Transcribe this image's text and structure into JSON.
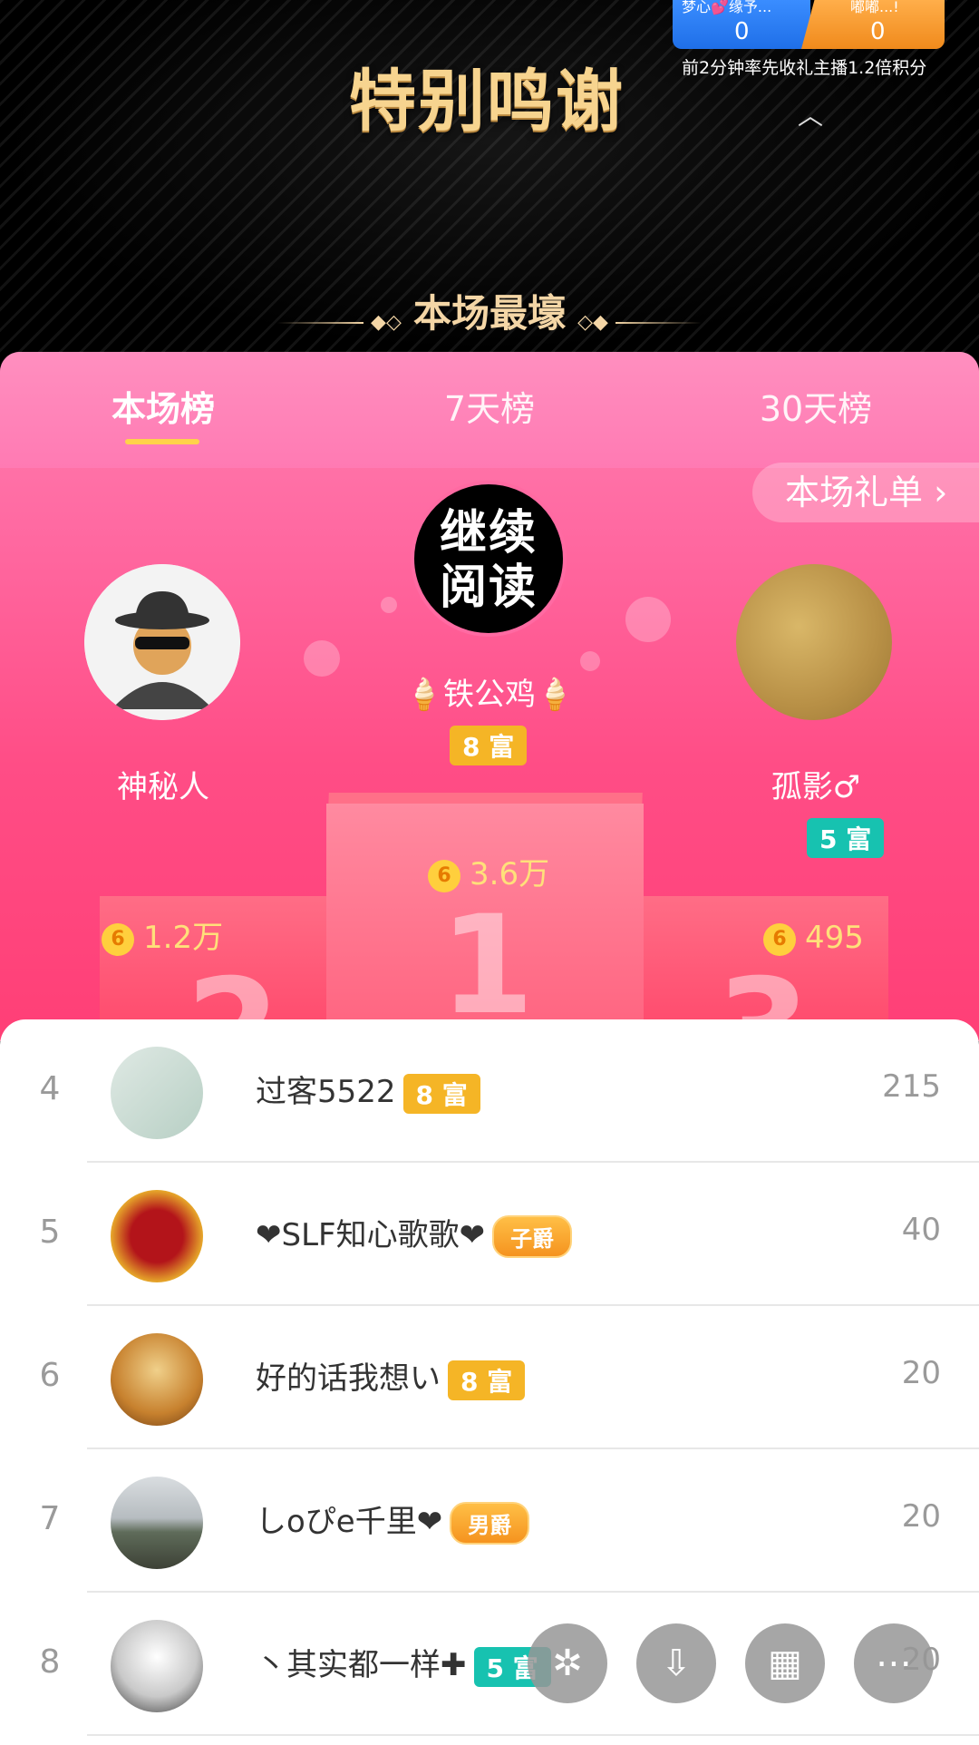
{
  "header": {
    "title": "特别鸣谢",
    "pk": {
      "left_name": "梦心💕缘予...",
      "right_name": "嘟嘟...!",
      "left_score": "0",
      "right_score": "0",
      "info": "前2分钟率先收礼主播1.2倍积分",
      "collapse_icon": "chevron-up-icon"
    },
    "section_title": "本场最壕"
  },
  "tabs": [
    "本场榜",
    "7天榜",
    "30天榜"
  ],
  "gift_list_label": "本场礼单 ›",
  "podium": {
    "first": {
      "avatar_text": "继续\n阅读",
      "name": "铁公鸡",
      "badge": "8 富",
      "amount": "3.6万",
      "rank": "1"
    },
    "second": {
      "name": "神秘人",
      "amount": "1.2万",
      "rank": "2"
    },
    "third": {
      "name": "孤影♂",
      "badge": "5 富",
      "amount": "495",
      "rank": "3"
    }
  },
  "list": [
    {
      "rank": "4",
      "name": "过客5522",
      "badge": "8 富",
      "badge_type": "rich-yellow",
      "score": "215"
    },
    {
      "rank": "5",
      "name": "❤SLF知心歌歌❤",
      "badge": "子爵",
      "badge_type": "noble",
      "score": "40"
    },
    {
      "rank": "6",
      "name": "好的话我想い",
      "badge": "8 富",
      "badge_type": "rich-yellow",
      "score": "20"
    },
    {
      "rank": "7",
      "name": "しoぴe千里❤",
      "badge": "男爵",
      "badge_type": "noble",
      "score": "20"
    },
    {
      "rank": "8",
      "name": "丶其实都一样✚",
      "badge": "5 富",
      "badge_type": "rich-teal",
      "score": "20"
    }
  ],
  "floating_buttons": [
    "sparkle-icon",
    "download-icon",
    "grid-icon",
    "more-icon"
  ],
  "colors": {
    "pink": "#ff5a93",
    "rich_yellow": "#f5b526",
    "rich_teal": "#17c2b0",
    "gold_text": "#f7d48f"
  }
}
